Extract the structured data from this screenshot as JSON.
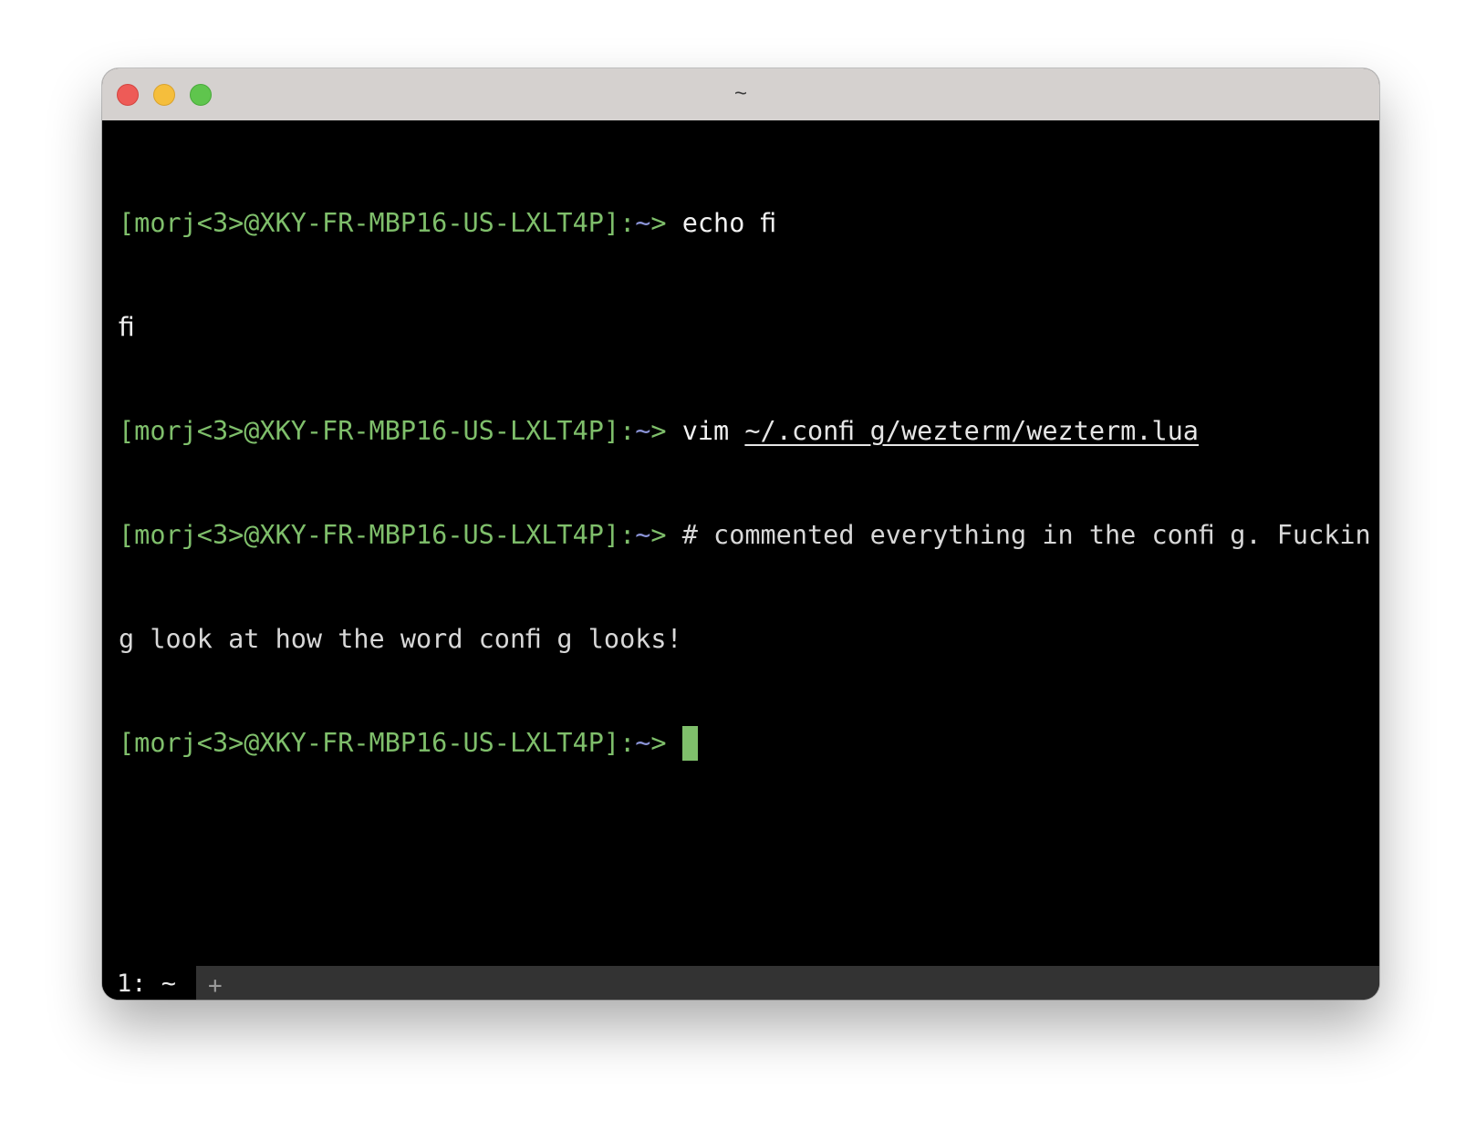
{
  "window": {
    "title": "~"
  },
  "terminal": {
    "prompt_prefix": "[morj<3>@XKY-FR-MBP16-US-LXLT4P]:",
    "prompt_tilde": "~",
    "prompt_arrow": "> ",
    "lines": [
      {
        "type": "prompt",
        "command": "echo ﬁ"
      },
      {
        "type": "output",
        "text": "ﬁ"
      },
      {
        "type": "prompt",
        "command": "vim ",
        "path": "~/.conﬁ g/wezterm/wezterm.lua"
      },
      {
        "type": "prompt",
        "command": "# commented everything in the conﬁ g. Fuckin"
      },
      {
        "type": "output",
        "text": "g look at how the word conﬁ g looks!"
      },
      {
        "type": "prompt",
        "command": "",
        "cursor": true
      }
    ]
  },
  "tabbar": {
    "active_tab_label": "1: ~",
    "new_tab_label": "+"
  },
  "colors": {
    "prompt_green": "#7fbf6b",
    "prompt_tilde_blue": "#8b94d8",
    "cursor": "#7fbf6b",
    "background": "#000000",
    "titlebar": "#d5d1cf",
    "tabbar": "#333333"
  }
}
